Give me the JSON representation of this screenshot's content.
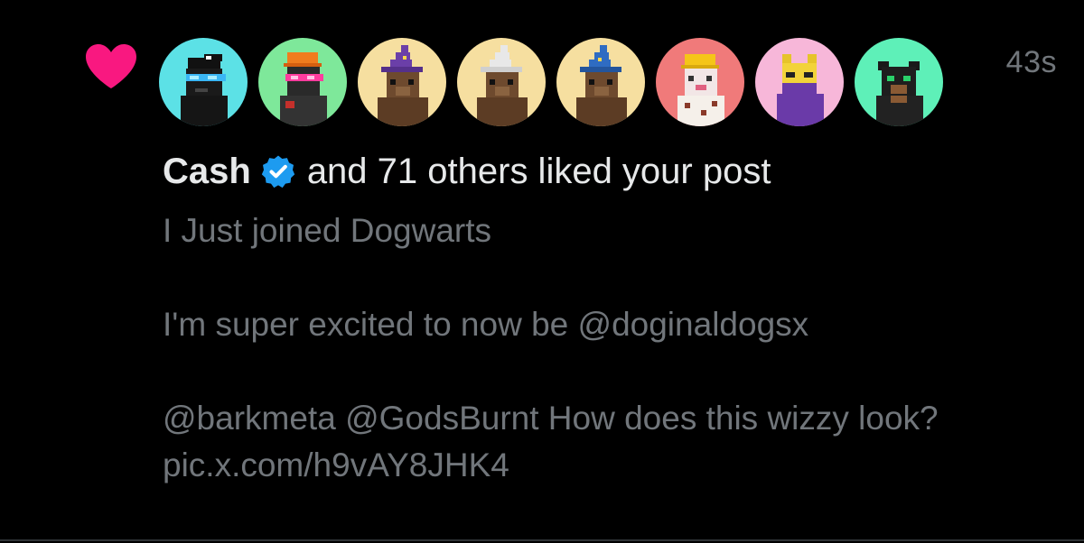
{
  "notification": {
    "type_icon": "heart-icon",
    "timestamp": "43s",
    "actor_name": "Cash",
    "actor_verified_icon": "verified-badge-icon",
    "action_text": "and 71 others liked your post",
    "post_text": "I Just joined Dogwarts\n\nI'm super excited to now be @doginaldogsx\n\n@barkmeta @GodsBurnt How does this wizzy look? pic.x.com/h9vAY8JHK4",
    "avatars": [
      {
        "icon": "pixel-dog-avatar",
        "bg": "#5ce1e6"
      },
      {
        "icon": "pixel-dog-avatar",
        "bg": "#7ee89a"
      },
      {
        "icon": "pixel-dog-avatar",
        "bg": "#f6dfa0"
      },
      {
        "icon": "pixel-dog-avatar",
        "bg": "#f6dfa0"
      },
      {
        "icon": "pixel-dog-avatar",
        "bg": "#f6dfa0"
      },
      {
        "icon": "pixel-dog-avatar",
        "bg": "#f07a7a"
      },
      {
        "icon": "pixel-dog-avatar",
        "bg": "#f7b7d9"
      },
      {
        "icon": "pixel-dog-avatar",
        "bg": "#5ef0b8"
      }
    ]
  },
  "colors": {
    "background": "#000000",
    "primary_text": "#e7e9ea",
    "secondary_text": "#71767b",
    "heart": "#f91880",
    "verified": "#1d9bf0"
  }
}
